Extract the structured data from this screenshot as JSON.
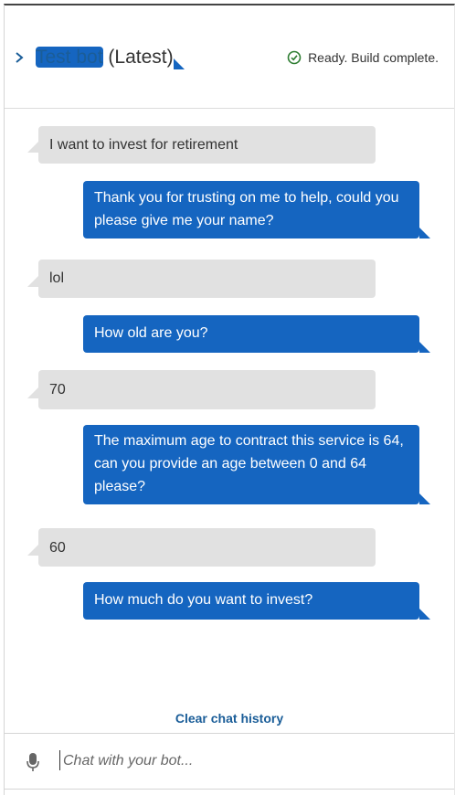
{
  "header": {
    "bot_name": "Test bot",
    "version": "(Latest)",
    "status": "Ready. Build complete."
  },
  "messages": [
    {
      "from": "user",
      "text": "I want to invest for retirement"
    },
    {
      "from": "bot",
      "text": "Thank you for trusting on me to help, could you please give me your name?"
    },
    {
      "from": "user",
      "text": "lol"
    },
    {
      "from": "bot",
      "text": "How old are you?"
    },
    {
      "from": "user",
      "text": "70"
    },
    {
      "from": "bot",
      "text": "The maximum age to contract this service is 64, can you provide an age between 0 and 64 please?"
    },
    {
      "from": "user",
      "text": "60"
    },
    {
      "from": "bot",
      "text": "How much do you want to invest?"
    }
  ],
  "clear_label": "Clear chat history",
  "input": {
    "placeholder": "Chat with your bot...",
    "value": ""
  },
  "colors": {
    "accent": "#1a5d98",
    "bot_bubble": "#1565c0",
    "user_bubble": "#e1e1e1",
    "status_ok": "#2e7d32"
  }
}
